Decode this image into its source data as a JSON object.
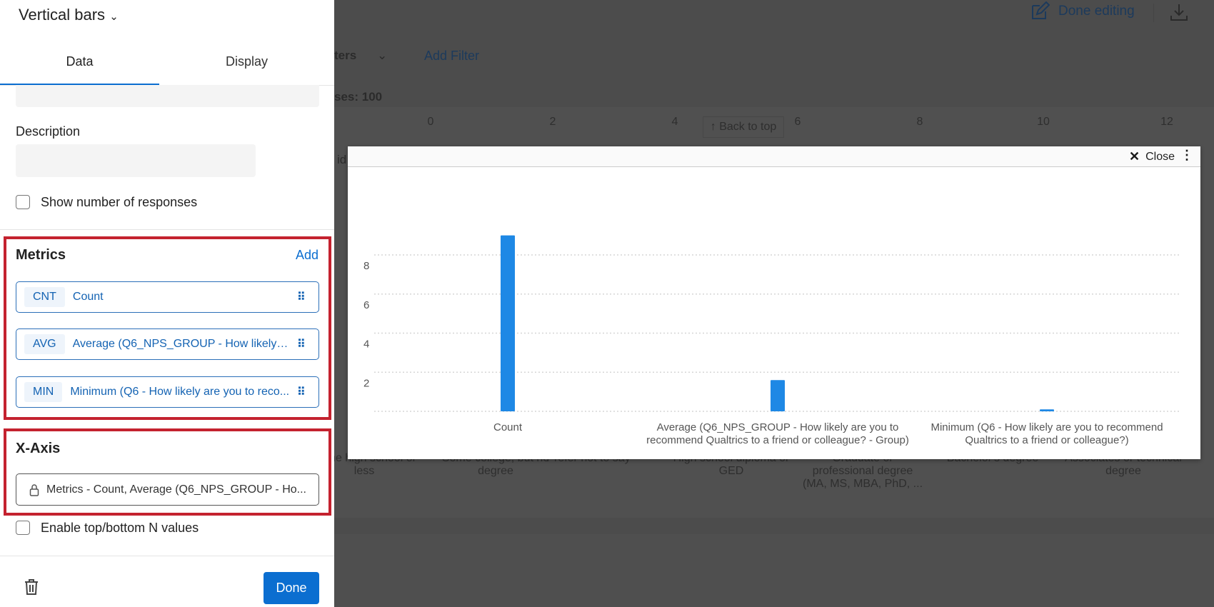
{
  "background": {
    "filters_label": "ters",
    "add_filter": "Add Filter",
    "responses": "ses: 100",
    "axis_ticks": [
      "0",
      "2",
      "4",
      "6",
      "8",
      "10",
      "12"
    ],
    "back_to_top": "↑ Back to top",
    "done_editing": "Done editing",
    "partial_label": "id",
    "categories": [
      "Some high school or less",
      "Some college, but no degree",
      "Prefer not to say",
      "High school diploma or GED",
      "Graduate or professional degree (MA, MS, MBA, PhD, ...",
      "Bachelor's degree",
      "Associates or technical degree"
    ]
  },
  "sidebar": {
    "title": "Vertical bars",
    "tabs": [
      "Data",
      "Display"
    ],
    "description_label": "Description",
    "show_responses_label": "Show number of responses",
    "metrics": {
      "heading": "Metrics",
      "add": "Add",
      "items": [
        {
          "badge": "CNT",
          "label": "Count"
        },
        {
          "badge": "AVG",
          "label": "Average (Q6_NPS_GROUP - How likely ar..."
        },
        {
          "badge": "MIN",
          "label": "Minimum (Q6 - How likely are you to reco..."
        }
      ]
    },
    "xaxis": {
      "heading": "X-Axis",
      "value": "Metrics - Count, Average (Q6_NPS_GROUP - Ho..."
    },
    "topn_label": "Enable top/bottom N values",
    "done": "Done"
  },
  "modal": {
    "close": "Close"
  },
  "chart_data": {
    "type": "bar",
    "categories": [
      "Count",
      "Average (Q6_NPS_GROUP - How likely are you to recommend Qualtrics to a friend or colleague? - Group)",
      "Minimum (Q6 - How likely are you to recommend Qualtrics to a friend or colleague?)"
    ],
    "category_lines": [
      [
        "Count"
      ],
      [
        "Average (Q6_NPS_GROUP - How likely are you to",
        "recommend Qualtrics to a friend or colleague? - Group)"
      ],
      [
        "Minimum (Q6 - How likely are you to recommend",
        "Qualtrics to a friend or colleague?)"
      ]
    ],
    "values": [
      9,
      1.6,
      0.1
    ],
    "yticks": [
      "2",
      "4",
      "6",
      "8"
    ],
    "ylim": [
      0,
      10
    ],
    "grid": true,
    "color": "#1e88e5"
  }
}
